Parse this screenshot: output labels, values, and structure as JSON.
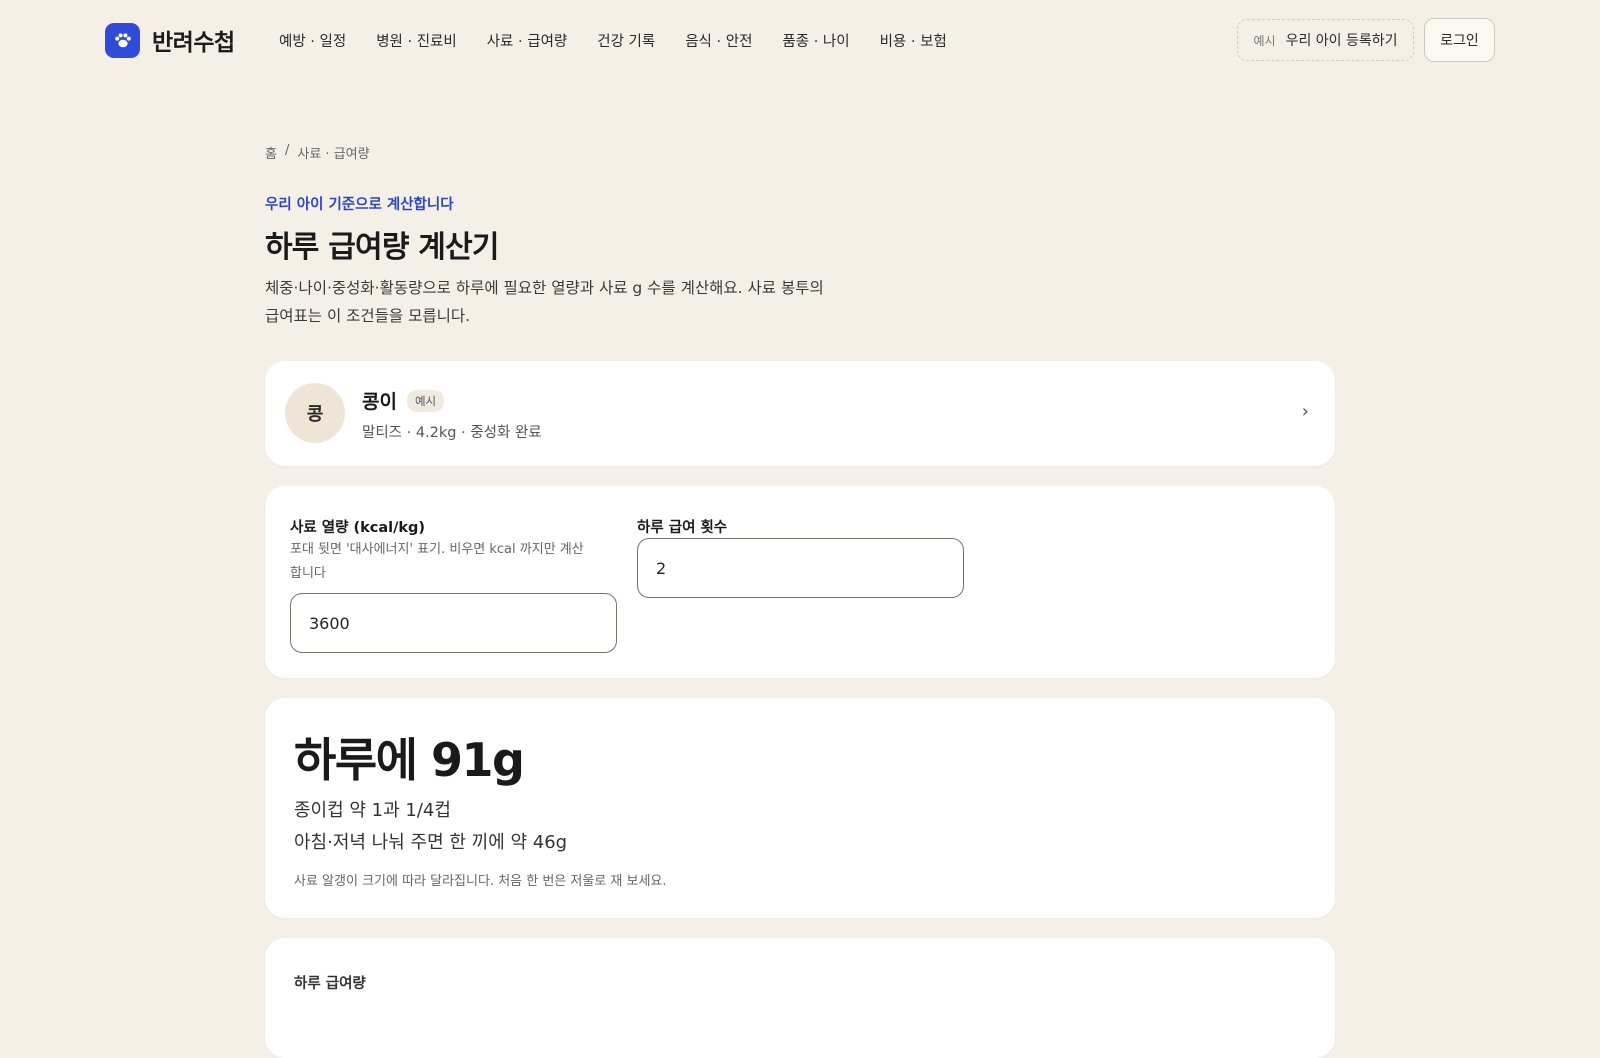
{
  "app": {
    "name": "반려수첩"
  },
  "nav": {
    "items": [
      {
        "label": "예방 · 일정"
      },
      {
        "label": "병원 · 진료비"
      },
      {
        "label": "사료 · 급여량"
      },
      {
        "label": "건강 기록"
      },
      {
        "label": "음식 · 안전"
      },
      {
        "label": "품종 · 나이"
      },
      {
        "label": "비용 · 보험"
      }
    ]
  },
  "header": {
    "register_badge": "예시",
    "register_label": "우리 아이 등록하기",
    "login_label": "로그인"
  },
  "breadcrumb": {
    "home": "홈",
    "sep": "/",
    "current": "사료 · 급여량"
  },
  "page": {
    "kicker": "우리 아이 기준으로 계산합니다",
    "title": "하루 급여량 계산기",
    "desc_line1": "체중·나이·중성화·활동량으로 하루에 필요한 열량과 사료 g 수를 계산해요. 사료 봉투의",
    "desc_line2": "급여표는 이 조건들을 모릅니다."
  },
  "pet": {
    "avatar": "콩",
    "name": "콩이",
    "badge": "예시",
    "meta": "말티즈 · 4.2kg · 중성화 완료"
  },
  "inputs": {
    "calorie_label": "사료 열량 (kcal/kg)",
    "calorie_hint": "포대 뒷면 '대사에너지' 표기. 비우면 kcal 까지만 계산합니다",
    "calorie_value": "3600",
    "meals_label": "하루 급여 횟수",
    "meals_value": "2"
  },
  "result": {
    "headline": "하루에 91g",
    "cups": "종이컵 약 1과 1/4컵",
    "per_meal": "아침·저녁 나눠 주면 한 끼에 약 46g",
    "note": "사료 알갱이 크기에 따라 달라집니다. 처음 한 번은 저울로 재 보세요."
  },
  "summary": {
    "label": "하루 급여량"
  },
  "colors": {
    "accent": "#2f4bd8",
    "background": "#f5f0e7",
    "card": "#ffffff"
  }
}
